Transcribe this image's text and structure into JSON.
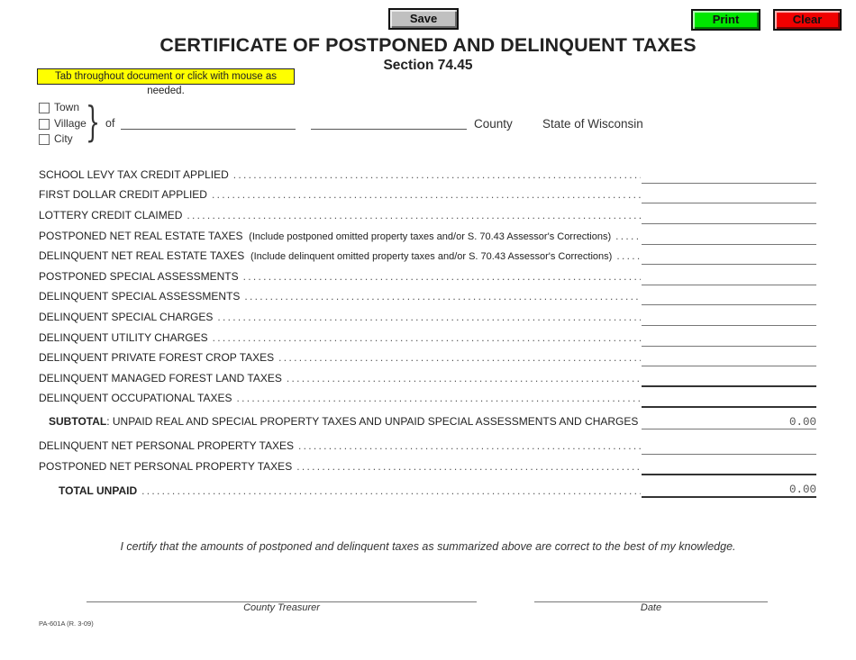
{
  "toolbar": {
    "save_label": "Save",
    "print_label": "Print",
    "clear_label": "Clear",
    "colors": {
      "save": "#c0c0c0",
      "print": "#00e600",
      "clear": "#f00000"
    }
  },
  "header": {
    "title": "CERTIFICATE OF POSTPONED AND DELINQUENT TAXES",
    "subtitle": "Section 74.45",
    "hint": "Tab throughout document or click with mouse as needed.",
    "hint_color": "#ffff00"
  },
  "municipality": {
    "options": [
      {
        "label": "Town",
        "checked": false
      },
      {
        "label": "Village",
        "checked": false
      },
      {
        "label": "City",
        "checked": false
      }
    ],
    "of_label": "of",
    "name_value": "",
    "county_value": "",
    "county_label": "County",
    "state_label": "State of Wisconsin"
  },
  "lines": [
    {
      "label": "SCHOOL LEVY TAX CREDIT APPLIED",
      "note": "",
      "value": ""
    },
    {
      "label": "FIRST DOLLAR CREDIT APPLIED",
      "note": "",
      "value": ""
    },
    {
      "label": "LOTTERY CREDIT CLAIMED",
      "note": "",
      "value": ""
    },
    {
      "label": "POSTPONED NET REAL ESTATE TAXES",
      "note": "(Include postponed omitted property taxes and/or S. 70.43 Assessor's Corrections)",
      "value": ""
    },
    {
      "label": "DELINQUENT NET REAL ESTATE TAXES",
      "note": "(Include delinquent omitted property taxes and/or S. 70.43 Assessor's Corrections)",
      "value": ""
    },
    {
      "label": "POSTPONED SPECIAL ASSESSMENTS",
      "note": "",
      "value": ""
    },
    {
      "label": "DELINQUENT SPECIAL ASSESSMENTS",
      "note": "",
      "value": ""
    },
    {
      "label": "DELINQUENT SPECIAL CHARGES",
      "note": "",
      "value": ""
    },
    {
      "label": "DELINQUENT UTILITY CHARGES",
      "note": "",
      "value": ""
    },
    {
      "label": "DELINQUENT PRIVATE FOREST CROP TAXES",
      "note": "",
      "value": ""
    },
    {
      "label": "DELINQUENT MANAGED FOREST LAND TAXES",
      "note": "",
      "value": ""
    },
    {
      "label": "DELINQUENT OCCUPATIONAL TAXES",
      "note": "",
      "value": ""
    }
  ],
  "subtotal": {
    "bold_label": "SUBTOTAL",
    "label": ":  UNPAID REAL AND SPECIAL PROPERTY TAXES AND UNPAID SPECIAL ASSESSMENTS AND CHARGES",
    "value": "0.00"
  },
  "personal_lines": [
    {
      "label": "DELINQUENT NET PERSONAL PROPERTY TAXES",
      "value": ""
    },
    {
      "label": "POSTPONED NET PERSONAL PROPERTY TAXES",
      "value": ""
    }
  ],
  "total": {
    "label": "TOTAL UNPAID",
    "value": "0.00"
  },
  "footer": {
    "certify": "I certify that the amounts of postponed and delinquent taxes as summarized above are correct to the best of my knowledge.",
    "treasurer_label": "County Treasurer",
    "date_label": "Date",
    "form_number": "PA-601A (R. 3-09)"
  }
}
